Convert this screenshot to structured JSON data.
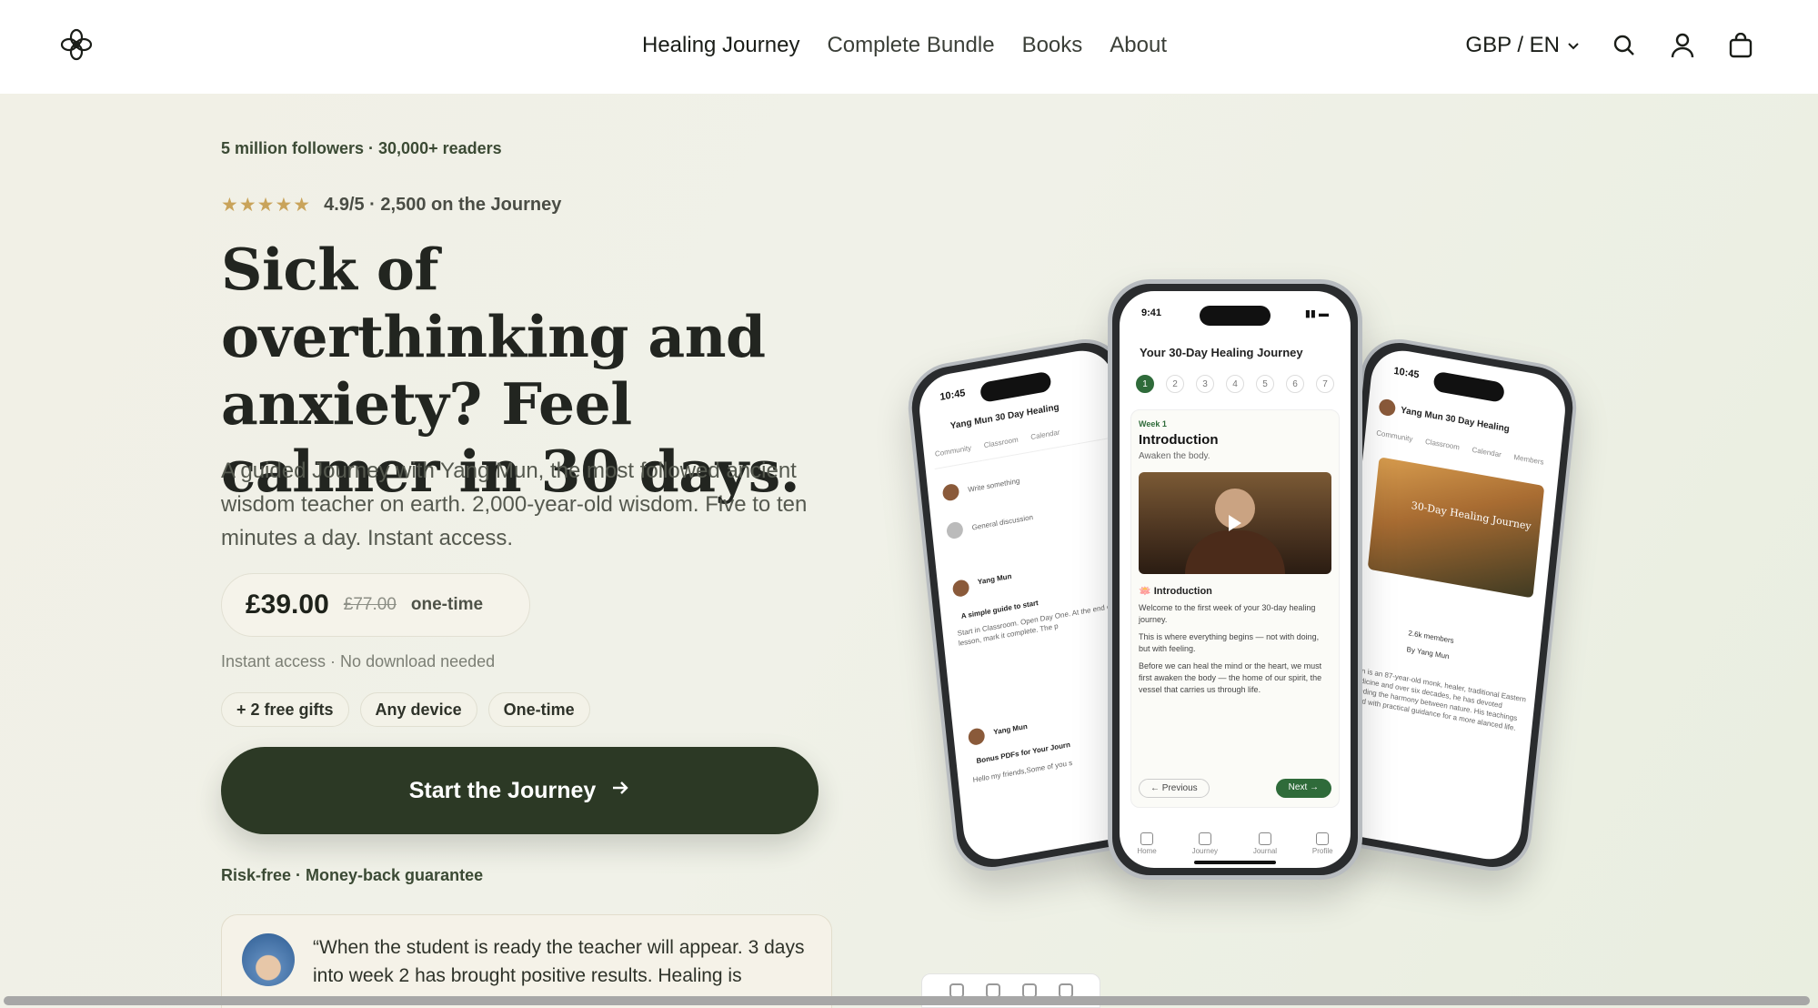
{
  "header": {
    "nav": [
      "Healing Journey",
      "Complete Bundle",
      "Books",
      "About"
    ],
    "locale": "GBP / EN"
  },
  "hero": {
    "followers": "5 million followers · 30,000+ readers",
    "stars": "★★★★★",
    "rating": "4.9/5 · 2,500 on the Journey",
    "headline": "Sick of overthinking and anxiety? Feel calmer in 30 days.",
    "subcopy": "A guided Journey with Yang Mun, the most followed ancient wisdom teacher on earth. 2,000-year-old wisdom. Five to ten minutes a day. Instant access.",
    "price": "£39.00",
    "old_price": "£77.00",
    "price_note": "one-time",
    "access": "Instant access · No download needed",
    "chips": [
      "+ 2 free gifts",
      "Any device",
      "One-time"
    ],
    "cta": "Start the Journey",
    "guarantee": "Risk-free · Money-back guarantee",
    "testimonial": "“When the student is ready the teacher will appear. 3 days into week 2 has brought positive results. Healing is"
  },
  "phone_center": {
    "time": "9:41",
    "title": "Your 30-Day Healing Journey",
    "days": [
      "1",
      "2",
      "3",
      "4",
      "5",
      "6",
      "7"
    ],
    "week": "Week 1",
    "intro_title": "Introduction",
    "intro_sub": "Awaken the body.",
    "lesson_title": "🪷 Introduction",
    "p1": "Welcome to the first week of your 30-day healing journey.",
    "p2": "This is where everything begins — not with doing, but with feeling.",
    "p3": "Before we can heal the mind or the heart, we must first awaken the body — the home of our spirit, the vessel that carries us through life.",
    "prev": "← Previous",
    "next": "Next →",
    "tabs": [
      "Home",
      "Journey",
      "Journal",
      "Profile"
    ]
  },
  "phone_left": {
    "time": "10:45",
    "title": "Yang Mun 30 Day Healing",
    "tabs": [
      "Community",
      "Classroom",
      "Calendar"
    ],
    "write": "Write something",
    "general": "General discussion",
    "author": "Yang Mun",
    "post1": "A simple guide to start",
    "post1_body": "Start in Classroom. Open Day One. At the end of the lesson, mark it complete. The p",
    "post2": "Bonus PDFs for Your Journ",
    "post2_body": "Hello my friends,Some of you s"
  },
  "phone_right": {
    "time": "10:45",
    "title": "Yang Mun 30 Day Healing",
    "tabs": [
      "Community",
      "Classroom",
      "Calendar",
      "Members"
    ],
    "poster": "30-Day Healing Journey",
    "members": "2.6k members",
    "by": "By Yang Mun",
    "bio": "Mun is an 87-year-old monk, healer, traditional Eastern medicine and over six decades, he has devoted standing the harmony between nature. His teachings blend with practical guidance for a more alanced life."
  }
}
